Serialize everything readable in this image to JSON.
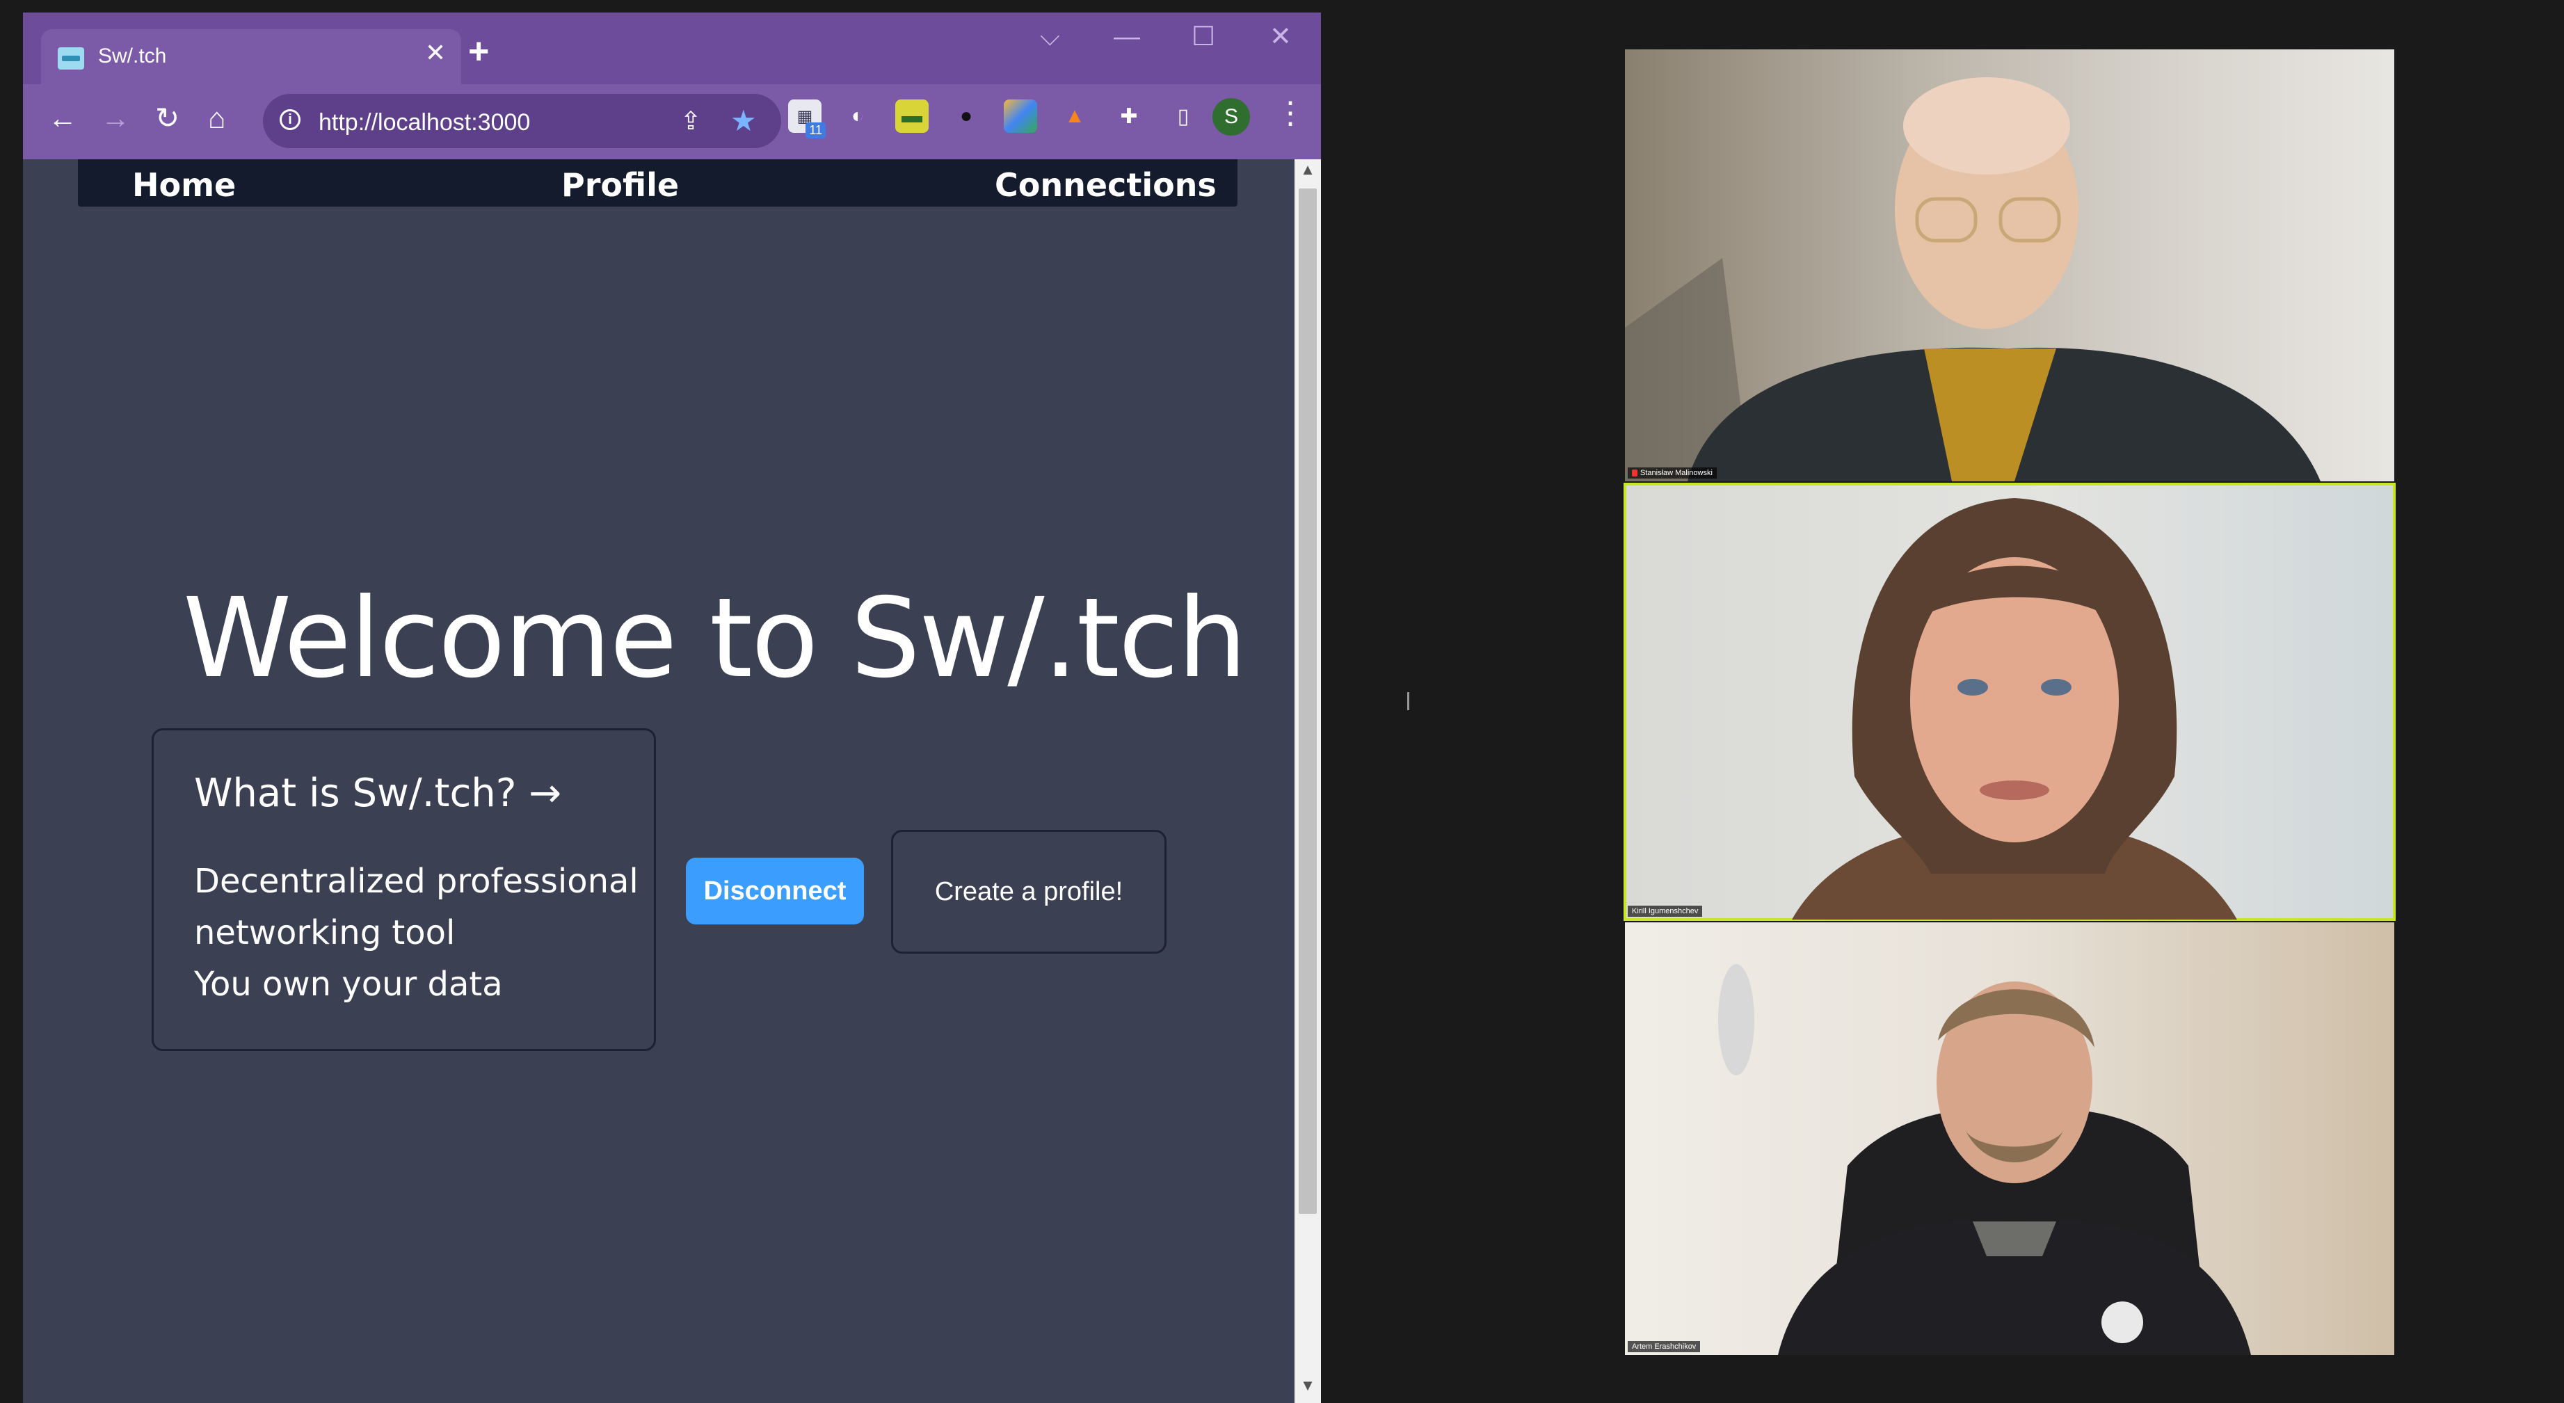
{
  "browser": {
    "tab_title": "Sw/.tch",
    "tab_close": "✕",
    "new_tab": "+",
    "url": "http://localhost:3000",
    "extension_badge": "11",
    "profile_initial": "S"
  },
  "site": {
    "nav": {
      "home": "Home",
      "profile": "Profile",
      "connections": "Connections"
    },
    "hero_title": "Welcome to Sw/.tch",
    "card": {
      "heading": "What is Sw/.tch? →",
      "lines": [
        "Decentralized professional",
        "networking tool",
        "You own your data"
      ]
    },
    "buttons": {
      "disconnect": "Disconnect",
      "create_profile": "Create a profile!"
    },
    "colors": {
      "page_bg": "#3b4052",
      "nav_bg": "#141b2d",
      "accent": "#3b9eff",
      "browser_frame": "#7b5aa8"
    }
  },
  "call": {
    "participants": [
      {
        "name": "Stanisław Malinowski",
        "muted": true
      },
      {
        "name": "Kirill Igumenshchev",
        "muted": false,
        "active_speaker": true
      },
      {
        "name": "Artem Erashchikov",
        "muted": false
      }
    ],
    "active_speaker_color": "#c8e628"
  },
  "icons": [
    "back-arrow-icon",
    "forward-arrow-icon",
    "reload-icon",
    "home-icon",
    "info-icon",
    "share-icon",
    "star-icon",
    "puzzle-icon",
    "side-panel-icon",
    "kebab-menu-icon",
    "minimize-icon",
    "maximize-icon",
    "close-icon",
    "chevron-down-icon",
    "mic-off-icon"
  ]
}
